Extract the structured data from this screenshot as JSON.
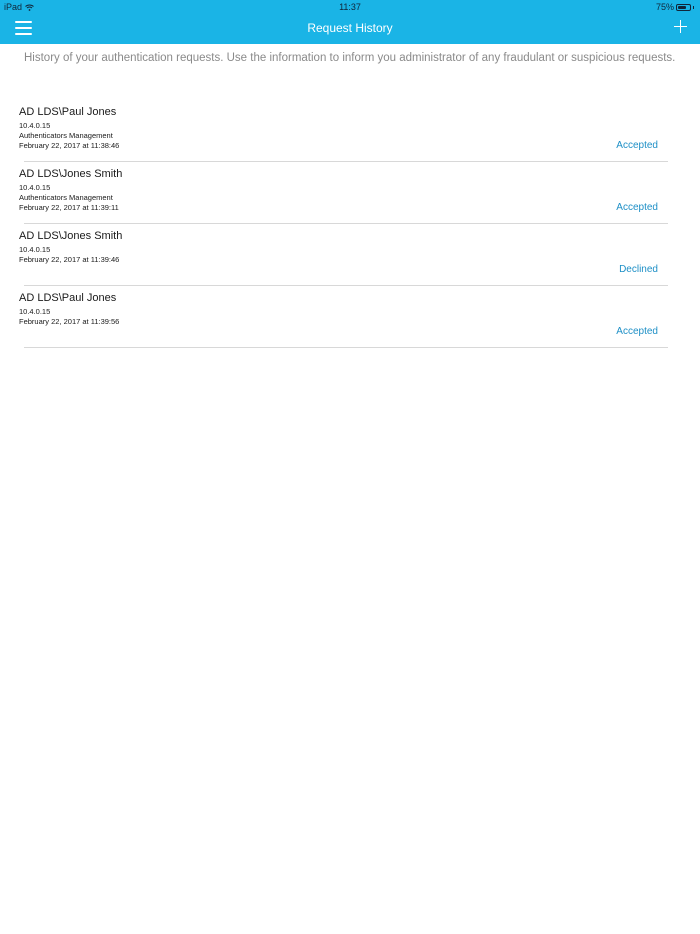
{
  "status_bar": {
    "carrier": "iPad",
    "time": "11:37",
    "battery": "75%",
    "battery_level": 0.75
  },
  "nav": {
    "title": "Request History",
    "menu_icon": "hamburger-menu-icon",
    "add_icon": "plus-icon"
  },
  "description": "History of your authentication requests. Use the information to inform you administrator of any fraudulant or suspicious requests.",
  "requests": [
    {
      "user": "AD LDS\\Paul Jones",
      "ip": "10.4.0.15",
      "application": "Authenticators Management",
      "timestamp": "February 22, 2017 at 11:38:46",
      "status": "Accepted"
    },
    {
      "user": "AD LDS\\Jones Smith",
      "ip": "10.4.0.15",
      "application": "Authenticators Management",
      "timestamp": "February 22, 2017 at 11:39:11",
      "status": "Accepted"
    },
    {
      "user": "AD LDS\\Jones Smith",
      "ip": "10.4.0.15",
      "application": "",
      "timestamp": "February 22, 2017 at 11:39:46",
      "status": "Declined"
    },
    {
      "user": "AD LDS\\Paul Jones",
      "ip": "10.4.0.15",
      "application": "",
      "timestamp": "February 22, 2017 at 11:39:56",
      "status": "Accepted"
    }
  ],
  "colors": {
    "header": "#1ab4e6",
    "status_link": "#1d8fc6"
  }
}
